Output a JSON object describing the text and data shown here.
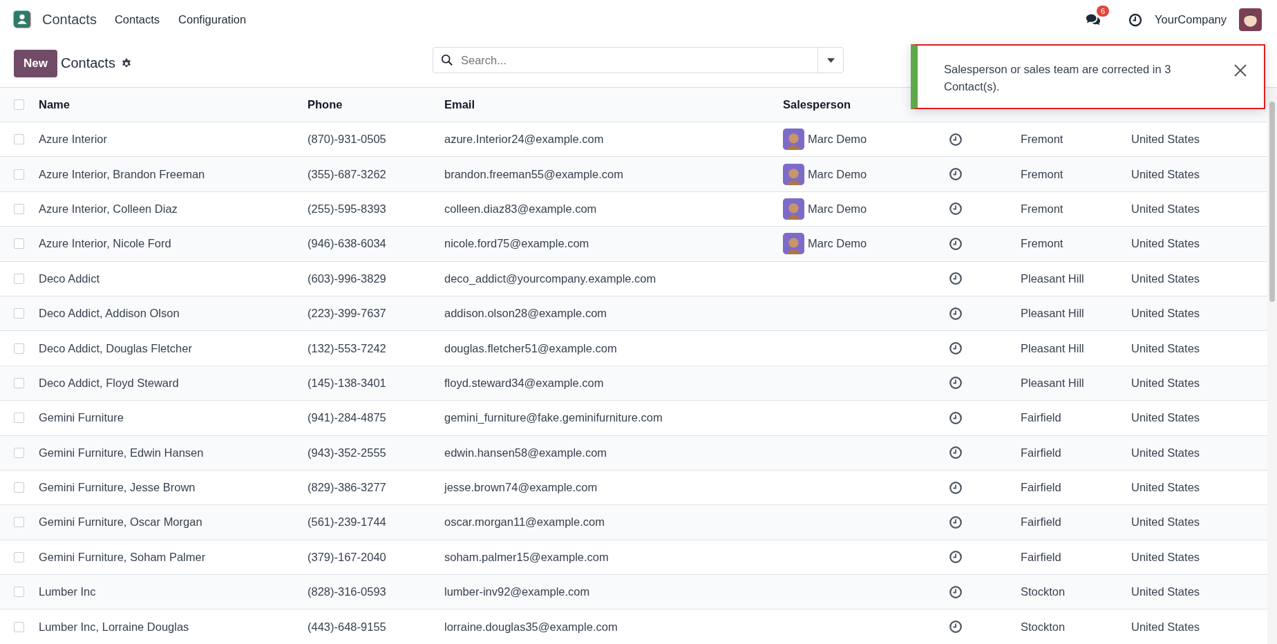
{
  "app": {
    "name": "Contacts"
  },
  "menu": [
    "Contacts",
    "Configuration"
  ],
  "systray": {
    "messages_badge": "6",
    "company": "YourCompany"
  },
  "control_panel": {
    "new_button": "New",
    "breadcrumb": "Contacts",
    "search": {
      "placeholder": "Search..."
    }
  },
  "notification": {
    "message": "Salesperson or sales team are corrected in 3 Contact(s)."
  },
  "table": {
    "select_all_checked": false,
    "columns": [
      "Name",
      "Phone",
      "Email",
      "Salesperson"
    ],
    "rows": [
      {
        "name": "Azure Interior",
        "phone": "(870)-931-0505",
        "email": "azure.Interior24@example.com",
        "salesperson": "Marc Demo",
        "city": "Fremont",
        "country": "United States",
        "checked": false
      },
      {
        "name": "Azure Interior, Brandon Freeman",
        "phone": "(355)-687-3262",
        "email": "brandon.freeman55@example.com",
        "salesperson": "Marc Demo",
        "city": "Fremont",
        "country": "United States",
        "checked": false
      },
      {
        "name": "Azure Interior, Colleen Diaz",
        "phone": "(255)-595-8393",
        "email": "colleen.diaz83@example.com",
        "salesperson": "Marc Demo",
        "city": "Fremont",
        "country": "United States",
        "checked": false
      },
      {
        "name": "Azure Interior, Nicole Ford",
        "phone": "(946)-638-6034",
        "email": "nicole.ford75@example.com",
        "salesperson": "Marc Demo",
        "city": "Fremont",
        "country": "United States",
        "checked": false
      },
      {
        "name": "Deco Addict",
        "phone": "(603)-996-3829",
        "email": "deco_addict@yourcompany.example.com",
        "city": "Pleasant Hill",
        "country": "United States",
        "checked": false
      },
      {
        "name": "Deco Addict, Addison Olson",
        "phone": "(223)-399-7637",
        "email": "addison.olson28@example.com",
        "city": "Pleasant Hill",
        "country": "United States",
        "checked": false
      },
      {
        "name": "Deco Addict, Douglas Fletcher",
        "phone": "(132)-553-7242",
        "email": "douglas.fletcher51@example.com",
        "city": "Pleasant Hill",
        "country": "United States",
        "checked": false
      },
      {
        "name": "Deco Addict, Floyd Steward",
        "phone": "(145)-138-3401",
        "email": "floyd.steward34@example.com",
        "city": "Pleasant Hill",
        "country": "United States",
        "checked": false
      },
      {
        "name": "Gemini Furniture",
        "phone": "(941)-284-4875",
        "email": "gemini_furniture@fake.geminifurniture.com",
        "city": "Fairfield",
        "country": "United States",
        "checked": false
      },
      {
        "name": "Gemini Furniture, Edwin Hansen",
        "phone": "(943)-352-2555",
        "email": "edwin.hansen58@example.com",
        "city": "Fairfield",
        "country": "United States",
        "checked": false
      },
      {
        "name": "Gemini Furniture, Jesse Brown",
        "phone": "(829)-386-3277",
        "email": "jesse.brown74@example.com",
        "city": "Fairfield",
        "country": "United States",
        "checked": false
      },
      {
        "name": "Gemini Furniture, Oscar Morgan",
        "phone": "(561)-239-1744",
        "email": "oscar.morgan11@example.com",
        "city": "Fairfield",
        "country": "United States",
        "checked": false
      },
      {
        "name": "Gemini Furniture, Soham Palmer",
        "phone": "(379)-167-2040",
        "email": "soham.palmer15@example.com",
        "city": "Fairfield",
        "country": "United States",
        "checked": false
      },
      {
        "name": "Lumber Inc",
        "phone": "(828)-316-0593",
        "email": "lumber-inv92@example.com",
        "city": "Stockton",
        "country": "United States",
        "checked": false
      },
      {
        "name": "Lumber Inc, Lorraine Douglas",
        "phone": "(443)-648-9155",
        "email": "lorraine.douglas35@example.com",
        "city": "Stockton",
        "country": "United States",
        "checked": false
      }
    ]
  }
}
